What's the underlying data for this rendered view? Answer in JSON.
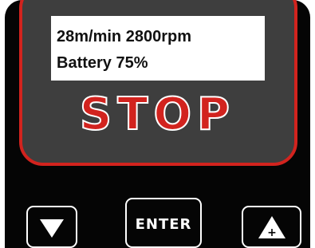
{
  "display": {
    "line1": "28m/min 2800rpm",
    "line2": "Battery 75%"
  },
  "status": {
    "text": "STOP"
  },
  "buttons": {
    "down_icon": "down-triangle-icon",
    "enter_label": "ENTER",
    "up_icon": "up-triangle-plus-icon",
    "up_symbol": "+"
  },
  "colors": {
    "accent_red": "#d2231e",
    "panel_gray": "#3e3e3e",
    "body_black": "#050505",
    "lcd_background": "#ffffff"
  }
}
